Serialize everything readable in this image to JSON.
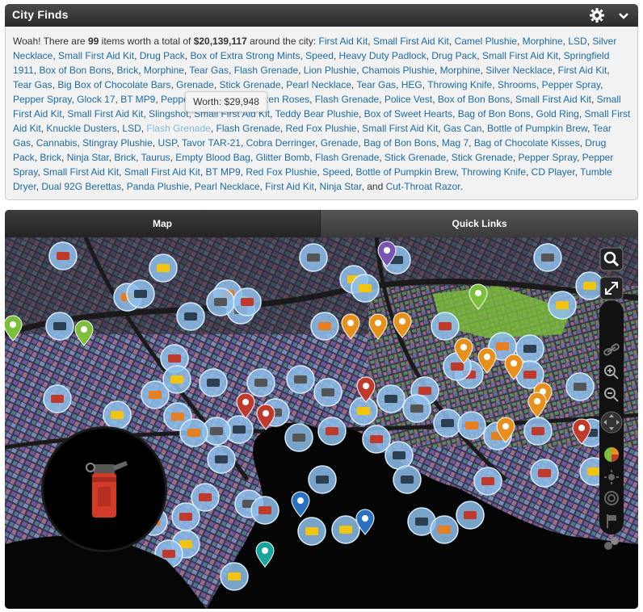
{
  "header": {
    "title": "City Finds",
    "gear_icon": "gear-icon",
    "collapse_icon": "chevron-down-icon"
  },
  "summary": {
    "intro": "Woah! There are ",
    "count": "99",
    "mid": " items worth a total of ",
    "total": "$20,139,117",
    "tail": " around the city: ",
    "last_sep": ", and ",
    "end": ".",
    "items": [
      "First Aid Kit",
      "Small First Aid Kit",
      "Camel Plushie",
      "Morphine",
      "LSD",
      "Silver Necklace",
      "Small First Aid Kit",
      "Drug Pack",
      "Box of Extra Strong Mints",
      "Speed",
      "Heavy Duty Padlock",
      "Drug Pack",
      "Small First Aid Kit",
      "Springfield 1911",
      "Box of Bon Bons",
      "Brick",
      "Morphine",
      "Tear Gas",
      "Flash Grenade",
      "Lion Plushie",
      "Chamois Plushie",
      "Morphine",
      "Silver Necklace",
      "First Aid Kit",
      "Tear Gas",
      "Big Box of Chocolate Bars",
      "Grenade",
      "Stick Grenade",
      "Pearl Necklace",
      "Tear Gas",
      "HEG",
      "Throwing Knife",
      "Shrooms",
      "Pepper Spray",
      "Pepper Spray",
      "Glock 17",
      "BT MP9",
      "Pepper",
      "First Aid Kit",
      "Dozen Roses",
      "Flash Grenade",
      "Police Vest",
      "Box of Bon Bons",
      "Small First Aid Kit",
      "Small First Aid Kit",
      "Small First Aid Kit",
      "Slingshot",
      "Small First Aid Kit",
      "Teddy Bear Plushie",
      "Box of Sweet Hearts",
      "Bag of Bon Bons",
      "Gold Ring",
      "Small First Aid Kit",
      "Knuckle Dusters",
      "LSD",
      "Flash Grenade",
      "Flash Grenade",
      "Red Fox Plushie",
      "Small First Aid Kit",
      "Gas Can",
      "Bottle of Pumpkin Brew",
      "Tear Gas",
      "Cannabis",
      "Stingray Plushie",
      "USP",
      "Tavor TAR-21",
      "Cobra Derringer",
      "Grenade",
      "Bag of Bon Bons",
      "Mag 7",
      "Bag of Chocolate Kisses",
      "Drug Pack",
      "Brick",
      "Ninja Star",
      "Brick",
      "Taurus",
      "Empty Blood Bag",
      "Glitter Bomb",
      "Flash Grenade",
      "Stick Grenade",
      "Stick Grenade",
      "Pepper Spray",
      "Pepper Spray",
      "Small First Aid Kit",
      "Small First Aid Kit",
      "BT MP9",
      "Red Fox Plushie",
      "Speed",
      "Bottle of Pumpkin Brew",
      "Throwing Knife",
      "CD Player",
      "Tumble Dryer",
      "Dual 92G Berettas",
      "Panda Plushie",
      "Pearl Necklace",
      "First Aid Kit",
      "Ninja Star",
      "Cut-Throat Razor"
    ],
    "hover_index": 55
  },
  "tooltip": {
    "text": "Worth: $29,948"
  },
  "tabs": [
    {
      "label": "Map"
    },
    {
      "label": "Quick Links"
    }
  ],
  "map": {
    "controls": [
      "search-icon",
      "fullscreen-icon",
      "link-icon",
      "zoom-in-icon",
      "zoom-out-icon",
      "pan-control-icon",
      "layers-color-icon",
      "sun-icon",
      "target-icon",
      "flag-icon",
      "circles-icon"
    ],
    "colors": {
      "pin_blue": "#8fc0ec",
      "pin_orange": "#e8901c",
      "pin_green": "#7cbf3a",
      "pin_red": "#c03a2b",
      "pin_purple": "#7a55b0"
    }
  }
}
